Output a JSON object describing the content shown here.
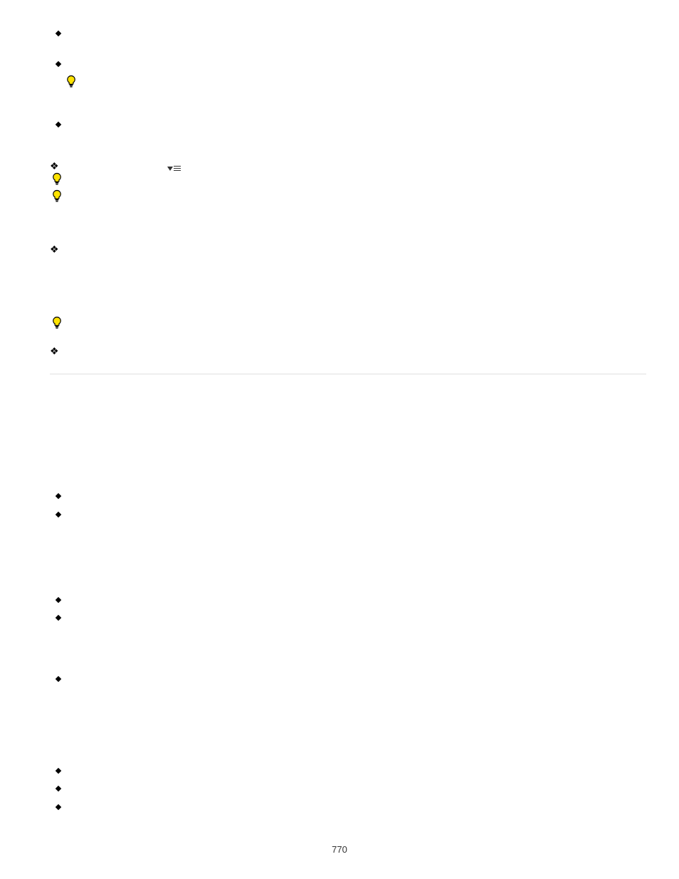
{
  "page_number": "770",
  "elements": {
    "bullet_1": "",
    "bullet_2": "",
    "tip_1": "",
    "bullet_3": "",
    "leaf_1": "",
    "listicon_1": "",
    "tip_2": "",
    "tip_3": "",
    "leaf_2": "",
    "tip_4": "",
    "leaf_3": "",
    "bullet_4": "",
    "bullet_5": "",
    "bullet_6": "",
    "bullet_7": "",
    "bullet_8": "",
    "bullet_9": "",
    "bullet_10": "",
    "bullet_11": ""
  }
}
